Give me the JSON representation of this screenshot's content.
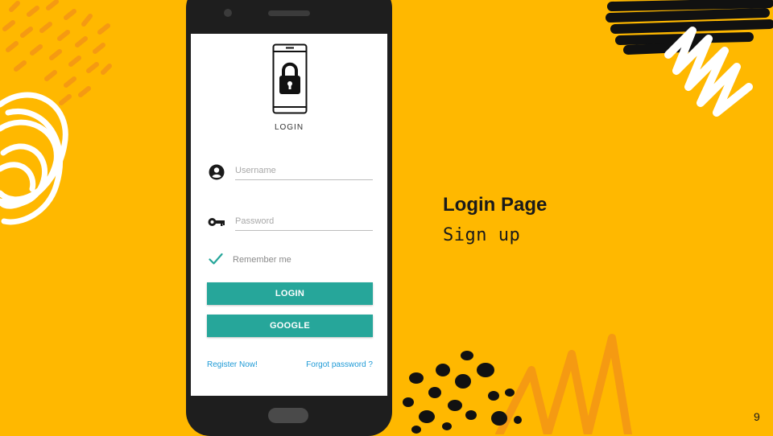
{
  "slide": {
    "title": "Login Page",
    "subtitle": "Sign up",
    "page_number": "9",
    "background_color": "#FFB800",
    "accent_color": "#26A69A"
  },
  "app": {
    "header_icon": "phone-lock-icon",
    "title": "LOGIN",
    "username": {
      "placeholder": "Username",
      "value": "",
      "icon": "account-circle-icon"
    },
    "password": {
      "placeholder": "Password",
      "value": "",
      "icon": "key-icon"
    },
    "remember": {
      "label": "Remember me",
      "checked": true,
      "icon": "checkmark-icon"
    },
    "login_button": "LOGIN",
    "google_button": "GOOGLE",
    "register_link": "Register Now!",
    "forgot_link": "Forgot password ?",
    "link_color": "#1E9AD6"
  }
}
